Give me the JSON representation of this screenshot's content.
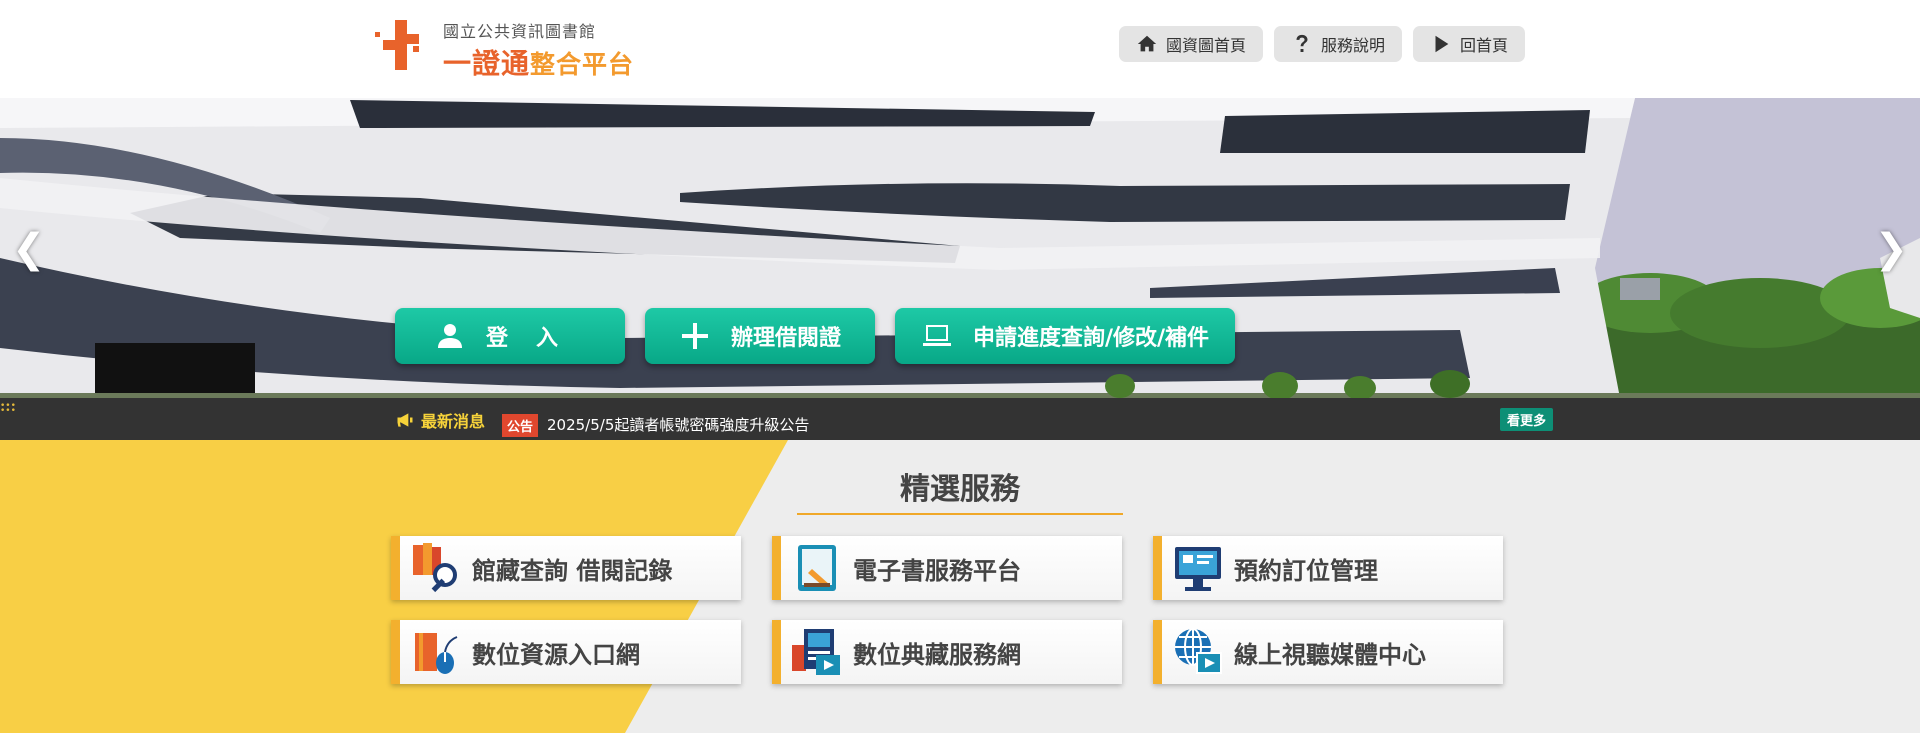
{
  "header": {
    "logo_small": "國立公共資訊圖書館",
    "logo_big_main": "一證通",
    "logo_big_accent": "整合平台",
    "nav": [
      {
        "label": "國資圖首頁",
        "icon": "home-icon"
      },
      {
        "label": "服務說明",
        "icon": "question-icon"
      },
      {
        "label": "回首頁",
        "icon": "play-icon"
      }
    ]
  },
  "banner": {
    "prev_arrow": "❮",
    "next_arrow": "❯",
    "actions": [
      {
        "label": "登入",
        "icon": "user-icon"
      },
      {
        "label": "辦理借閱證",
        "icon": "plus-icon"
      },
      {
        "label": "申請進度查詢/修改/補件",
        "icon": "laptop-icon"
      }
    ]
  },
  "news": {
    "title": "最新消息",
    "tag": "公告",
    "text": "2025/5/5起讀者帳號密碼強度升級公告",
    "more": "看更多"
  },
  "services": {
    "title": "精選服務",
    "items": [
      {
        "label": "館藏查詢 借閱記錄",
        "icon": "books-search-icon"
      },
      {
        "label": "電子書服務平台",
        "icon": "ebook-tablet-icon"
      },
      {
        "label": "預約訂位管理",
        "icon": "monitor-booking-icon"
      },
      {
        "label": "數位資源入口網",
        "icon": "book-mouse-icon"
      },
      {
        "label": "數位典藏服務網",
        "icon": "digital-archive-icon"
      },
      {
        "label": "線上視聽媒體中心",
        "icon": "globe-video-icon"
      }
    ]
  },
  "colors": {
    "brand_orange": "#e8632b",
    "accent_teal": "#10b894",
    "news_bg": "#333333",
    "service_yellow": "#f8cf45"
  }
}
